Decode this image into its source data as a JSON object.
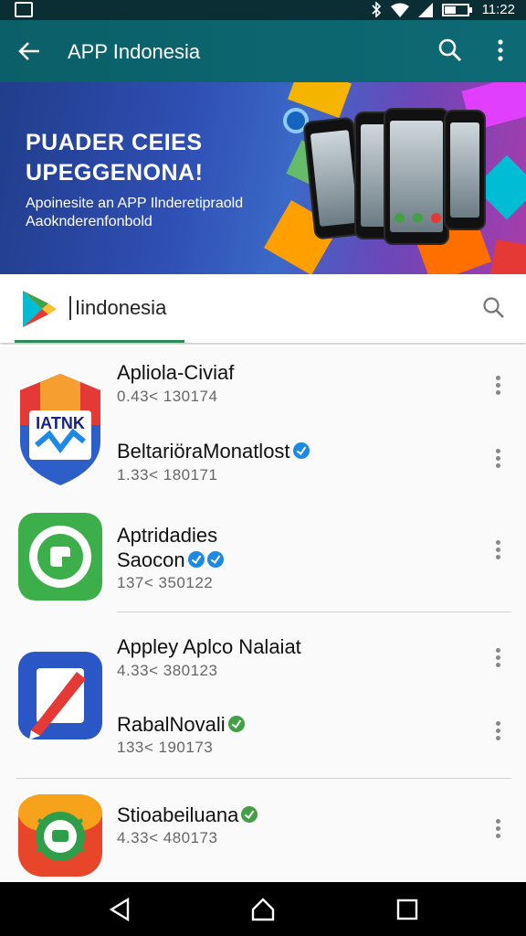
{
  "status_bar": {
    "time": "11:22"
  },
  "app_bar": {
    "title": "APP Indonesia"
  },
  "banner": {
    "headline_line1": "PUADER CEIES",
    "headline_line2": "UPEGGENONA!",
    "subtitle_line1": "Apoinesite an APP Ilnderetipraold",
    "subtitle_line2": "Aaoknderenfonbold"
  },
  "search": {
    "query": "Iindonesia"
  },
  "apps": [
    {
      "name": "Apliola-Civiaf",
      "meta": "0.43< 130174",
      "verified": false
    },
    {
      "name": "BeltariöraMonatlost",
      "meta": "1.33< 180171",
      "verified": true,
      "badge": "blue"
    },
    {
      "name": "Aptridadies",
      "meta": "",
      "verified": false
    },
    {
      "name": "Saocon",
      "meta": "137< 350122",
      "verified": true,
      "badge": "blue"
    },
    {
      "name": "Appley Aplco Nalaiat",
      "meta": "4.33< 380123",
      "verified": false
    },
    {
      "name": "RabalNovali",
      "meta": "133< 190173",
      "verified": true,
      "badge": "green"
    },
    {
      "name": "Stioabeiluana",
      "meta": "4.33< 480173",
      "verified": true,
      "badge": "green"
    }
  ],
  "icon_labels": {
    "app1": "IATNK"
  },
  "colors": {
    "app_bar": "#0b5f68",
    "status_bar": "#0a2e33",
    "accent_green": "#2e8b57",
    "verified_blue": "#1e88e5",
    "verified_green": "#43a047"
  },
  "icons": [
    "back-arrow-icon",
    "search-icon",
    "more-vert-icon",
    "play-store-icon",
    "wifi-icon",
    "bluetooth-icon",
    "battery-icon",
    "back-nav-icon",
    "home-nav-icon",
    "recents-nav-icon"
  ]
}
